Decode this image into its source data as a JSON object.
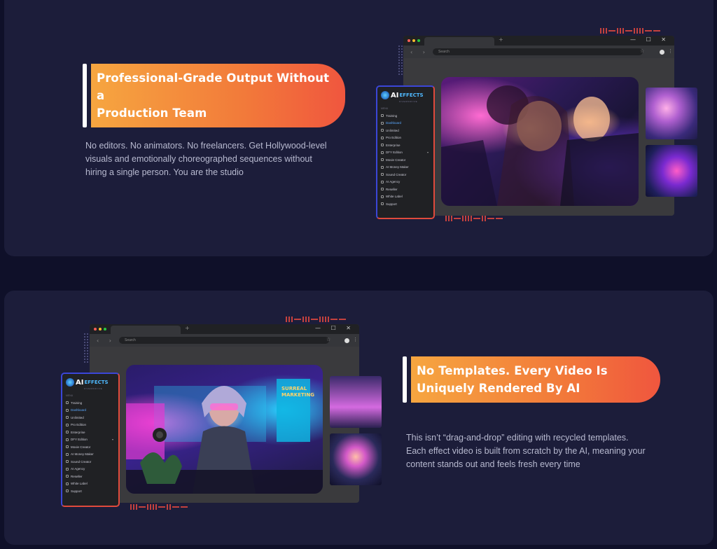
{
  "section1": {
    "headline_line1": "Professional-Grade Output Without a",
    "headline_line2": "Production Team",
    "body_line1": "No editors. No animators. No freelancers. Get Hollywood-level",
    "body_line2": "visuals and emotionally choreographed sequences without",
    "body_line3": "hiring a single person. You are the studio"
  },
  "section2": {
    "headline_line1": "No Templates. Every Video Is",
    "headline_line2": "Uniquely Rendered By AI",
    "body_line1": "This isn’t “drag-and-drop” editing with recycled templates.",
    "body_line2": "Each effect video is built from scratch by the AI, meaning your",
    "body_line3": "content stands out and feels fresh every time",
    "poster_text_1": "SURREAL",
    "poster_text_2": "MARKETING"
  },
  "browser": {
    "search_placeholder": "Search",
    "new_tab_symbol": "+",
    "window_controls": "— ☐ ✕",
    "nav_arrows": "‹ ›",
    "star_icon": "☆",
    "kebab_icon": "⋮"
  },
  "app": {
    "logo_ai": "AI",
    "logo_effects": "EFFECTS",
    "logo_sub": "OVERDRIVE",
    "menu_header": "MENU",
    "menu": [
      "Training",
      "Dashboard",
      "Unlimited",
      "Pro Edition",
      "Enterprise",
      "DFY Edition",
      "Movie Creator",
      "AI Money Maker",
      "Sound Creator",
      "AI Agency",
      "Reseller",
      "White Label",
      "Support"
    ],
    "chevron": "▾"
  },
  "colors": {
    "page_bg": "#0f1029",
    "card_bg": "#1c1d3a",
    "accent_orange": "#f27a3a",
    "panel_border_1": "#e04a3c",
    "panel_border_2": "#e04a3c",
    "panel_border_top": "#3b46d8"
  }
}
